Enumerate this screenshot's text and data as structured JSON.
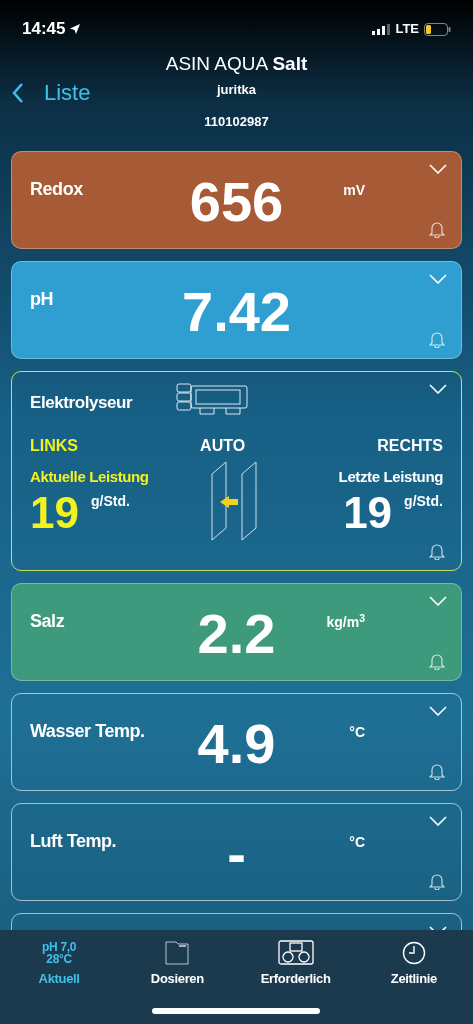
{
  "status_bar": {
    "time": "14:45",
    "network": "LTE"
  },
  "header": {
    "back": "Liste",
    "title": "ASIN AQUA",
    "title_bold": "Salt",
    "subtitle": "juritka",
    "serial": "110102987"
  },
  "cards": [
    {
      "kind": "measure",
      "label": "Redox",
      "value": "656",
      "unit": "mV",
      "color": "#a65a36"
    },
    {
      "kind": "measure",
      "label": "pH",
      "value": "7.42",
      "color": "#2e9fd0"
    },
    {
      "kind": "electrolyser",
      "label": "Elektrolyseur",
      "left": "LINKS",
      "mode": "AUTO",
      "right": "RECHTS",
      "left_caption": "Aktuelle Leistung",
      "left_value": "19",
      "left_unit": "g/Std.",
      "right_caption": "Letzte Leistung",
      "right_value": "19",
      "right_unit": "g/Std."
    },
    {
      "kind": "measure",
      "label": "Salz",
      "value": "2.2",
      "unit": "kg/m$^{3}$",
      "color": "#3d9a7c"
    },
    {
      "kind": "measure",
      "label": "Wasser Temp.",
      "value": "4.9",
      "unit": "°C"
    },
    {
      "kind": "measure",
      "label": "Luft Temp.",
      "value": "-",
      "unit": "°C"
    },
    {
      "kind": "partial"
    }
  ],
  "tabs": [
    {
      "kind": "reading",
      "line1": "pH 7,0",
      "line2": "28°C",
      "label": "Aktuell",
      "selected": true
    },
    {
      "kind": "folder",
      "label": "Dosieren",
      "selected": false
    },
    {
      "kind": "device",
      "label": "Erforderlich",
      "selected": false
    },
    {
      "kind": "clock",
      "label": "Zeitlinie",
      "selected": false
    }
  ]
}
